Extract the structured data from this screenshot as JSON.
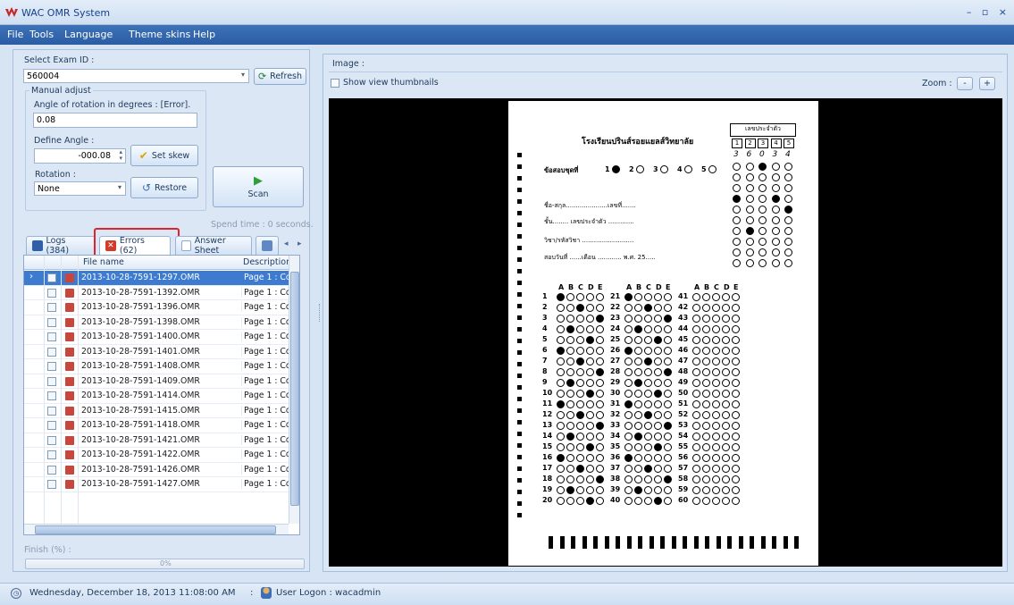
{
  "window": {
    "title": "WAC OMR System",
    "controls": "– ▫ ×"
  },
  "menu": [
    "File",
    "Tools",
    "Language",
    "Theme skins",
    "Help"
  ],
  "left": {
    "select_exam_label": "Select Exam ID :",
    "exam_id": "560004",
    "refresh_label": "Refresh",
    "manual_adjust_label": "Manual adjust",
    "angle_label": "Angle of rotation in degrees : [Error].",
    "angle_value": "0.08",
    "define_angle_label": "Define Angle :",
    "define_angle_value": "-000.08",
    "set_skew_label": "Set skew",
    "rotation_label": "Rotation :",
    "rotation_value": "None",
    "restore_label": "Restore",
    "scan_label": "Scan",
    "spend_time": "Spend time : 0 seconds.",
    "finish_label": "Finish (%) :",
    "progress": "0%"
  },
  "tabs": [
    {
      "label": "Logs (384)"
    },
    {
      "label": "Errors (62)"
    },
    {
      "label": "Answer Sheet"
    }
  ],
  "grid": {
    "columns": [
      "File name",
      "Description"
    ],
    "rows": [
      {
        "file": "2013-10-28-7591-1297.OMR",
        "desc": "Page 1 : Co"
      },
      {
        "file": "2013-10-28-7591-1392.OMR",
        "desc": "Page 1 : Co"
      },
      {
        "file": "2013-10-28-7591-1396.OMR",
        "desc": "Page 1 : Co"
      },
      {
        "file": "2013-10-28-7591-1398.OMR",
        "desc": "Page 1 : Co"
      },
      {
        "file": "2013-10-28-7591-1400.OMR",
        "desc": "Page 1 : Co"
      },
      {
        "file": "2013-10-28-7591-1401.OMR",
        "desc": "Page 1 : Co"
      },
      {
        "file": "2013-10-28-7591-1408.OMR",
        "desc": "Page 1 : Co"
      },
      {
        "file": "2013-10-28-7591-1409.OMR",
        "desc": "Page 1 : Co"
      },
      {
        "file": "2013-10-28-7591-1414.OMR",
        "desc": "Page 1 : Co"
      },
      {
        "file": "2013-10-28-7591-1415.OMR",
        "desc": "Page 1 : Co"
      },
      {
        "file": "2013-10-28-7591-1418.OMR",
        "desc": "Page 1 : Co"
      },
      {
        "file": "2013-10-28-7591-1421.OMR",
        "desc": "Page 1 : Co"
      },
      {
        "file": "2013-10-28-7591-1422.OMR",
        "desc": "Page 1 : Co"
      },
      {
        "file": "2013-10-28-7591-1426.OMR",
        "desc": "Page 1 : Co"
      },
      {
        "file": "2013-10-28-7591-1427.OMR",
        "desc": "Page 1 : Co"
      }
    ]
  },
  "right": {
    "image_label": "Image :",
    "thumbnails_label": "Show view thumbnails",
    "zoom_label": "Zoom :",
    "zoom_minus": "-",
    "zoom_plus": "+"
  },
  "sheet": {
    "school": "โรงเรียนปรินส์รอยแยลส์วิทยาลัย",
    "id_header": "เลขประจำตัว",
    "id_cols": [
      "1",
      "2",
      "3",
      "4",
      "5"
    ],
    "id_written": [
      "3",
      "6",
      "0",
      "3",
      "4"
    ],
    "choice_letters": [
      "A",
      "B",
      "C",
      "D",
      "E"
    ],
    "row1": "ข้อสอบชุดที่",
    "row_name": "ชื่อ-สกุล.....................เลขที่.......",
    "row_class": "ชั้น........ เลขประจำตัว .............",
    "row_subject": "วิชา/รหัสวิชา ..........................",
    "row_date": "สอบวันที่ ......เดือน ............ พ.ศ. 25.....",
    "set_opts": [
      "1",
      "2",
      "3",
      "4",
      "5"
    ]
  },
  "status": {
    "datetime": "Wednesday, December 18, 2013 11:08:00 AM",
    "sep": ":",
    "user": "User Logon : wacadmin"
  },
  "colors": {
    "highlight": "#e0242b",
    "selection": "#3d7bd1",
    "menubar": "#2f64ab"
  }
}
